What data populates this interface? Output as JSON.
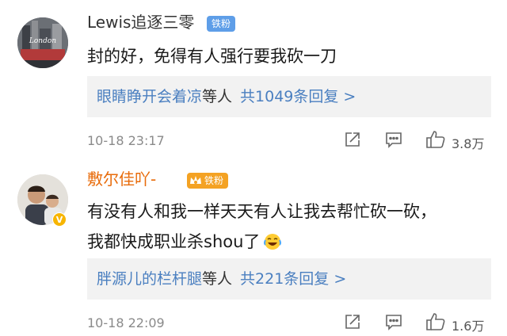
{
  "comments": [
    {
      "username": "Lewis追逐三零",
      "badge": "铁粉",
      "avatar_text": "London",
      "text_lines": [
        "封的好，免得有人强行要我砍一刀"
      ],
      "replies": {
        "name": "眼睛睁开会着凉",
        "suffix": "等人",
        "count": "共1049条回复 >"
      },
      "time": "10-18 23:17",
      "likes": "3.8万"
    },
    {
      "username": "敷尔佳吖-",
      "badge": "铁粉",
      "text_lines": [
        "有没有人和我一样天天有人让我去帮忙砍一砍，",
        "我都快成职业杀shou了"
      ],
      "replies": {
        "name": "胖源儿的栏杆腿",
        "suffix": "等人",
        "count": "共221条回复 >"
      },
      "time": "10-18 22:09",
      "likes": "1.6万"
    }
  ],
  "icons": {
    "share": "share-icon",
    "comment": "comment-icon",
    "like": "thumbs-up-icon",
    "emoji": "laugh-cry-emoji-icon",
    "verified": "verified-v-icon",
    "crown": "crown-icon"
  },
  "colors": {
    "vip_name": "#e86b0a",
    "link": "#4a7fc0",
    "badge_blue": "#5e9ee8",
    "badge_gold": "#f4a223",
    "reply_bg": "#f2f2f2"
  }
}
